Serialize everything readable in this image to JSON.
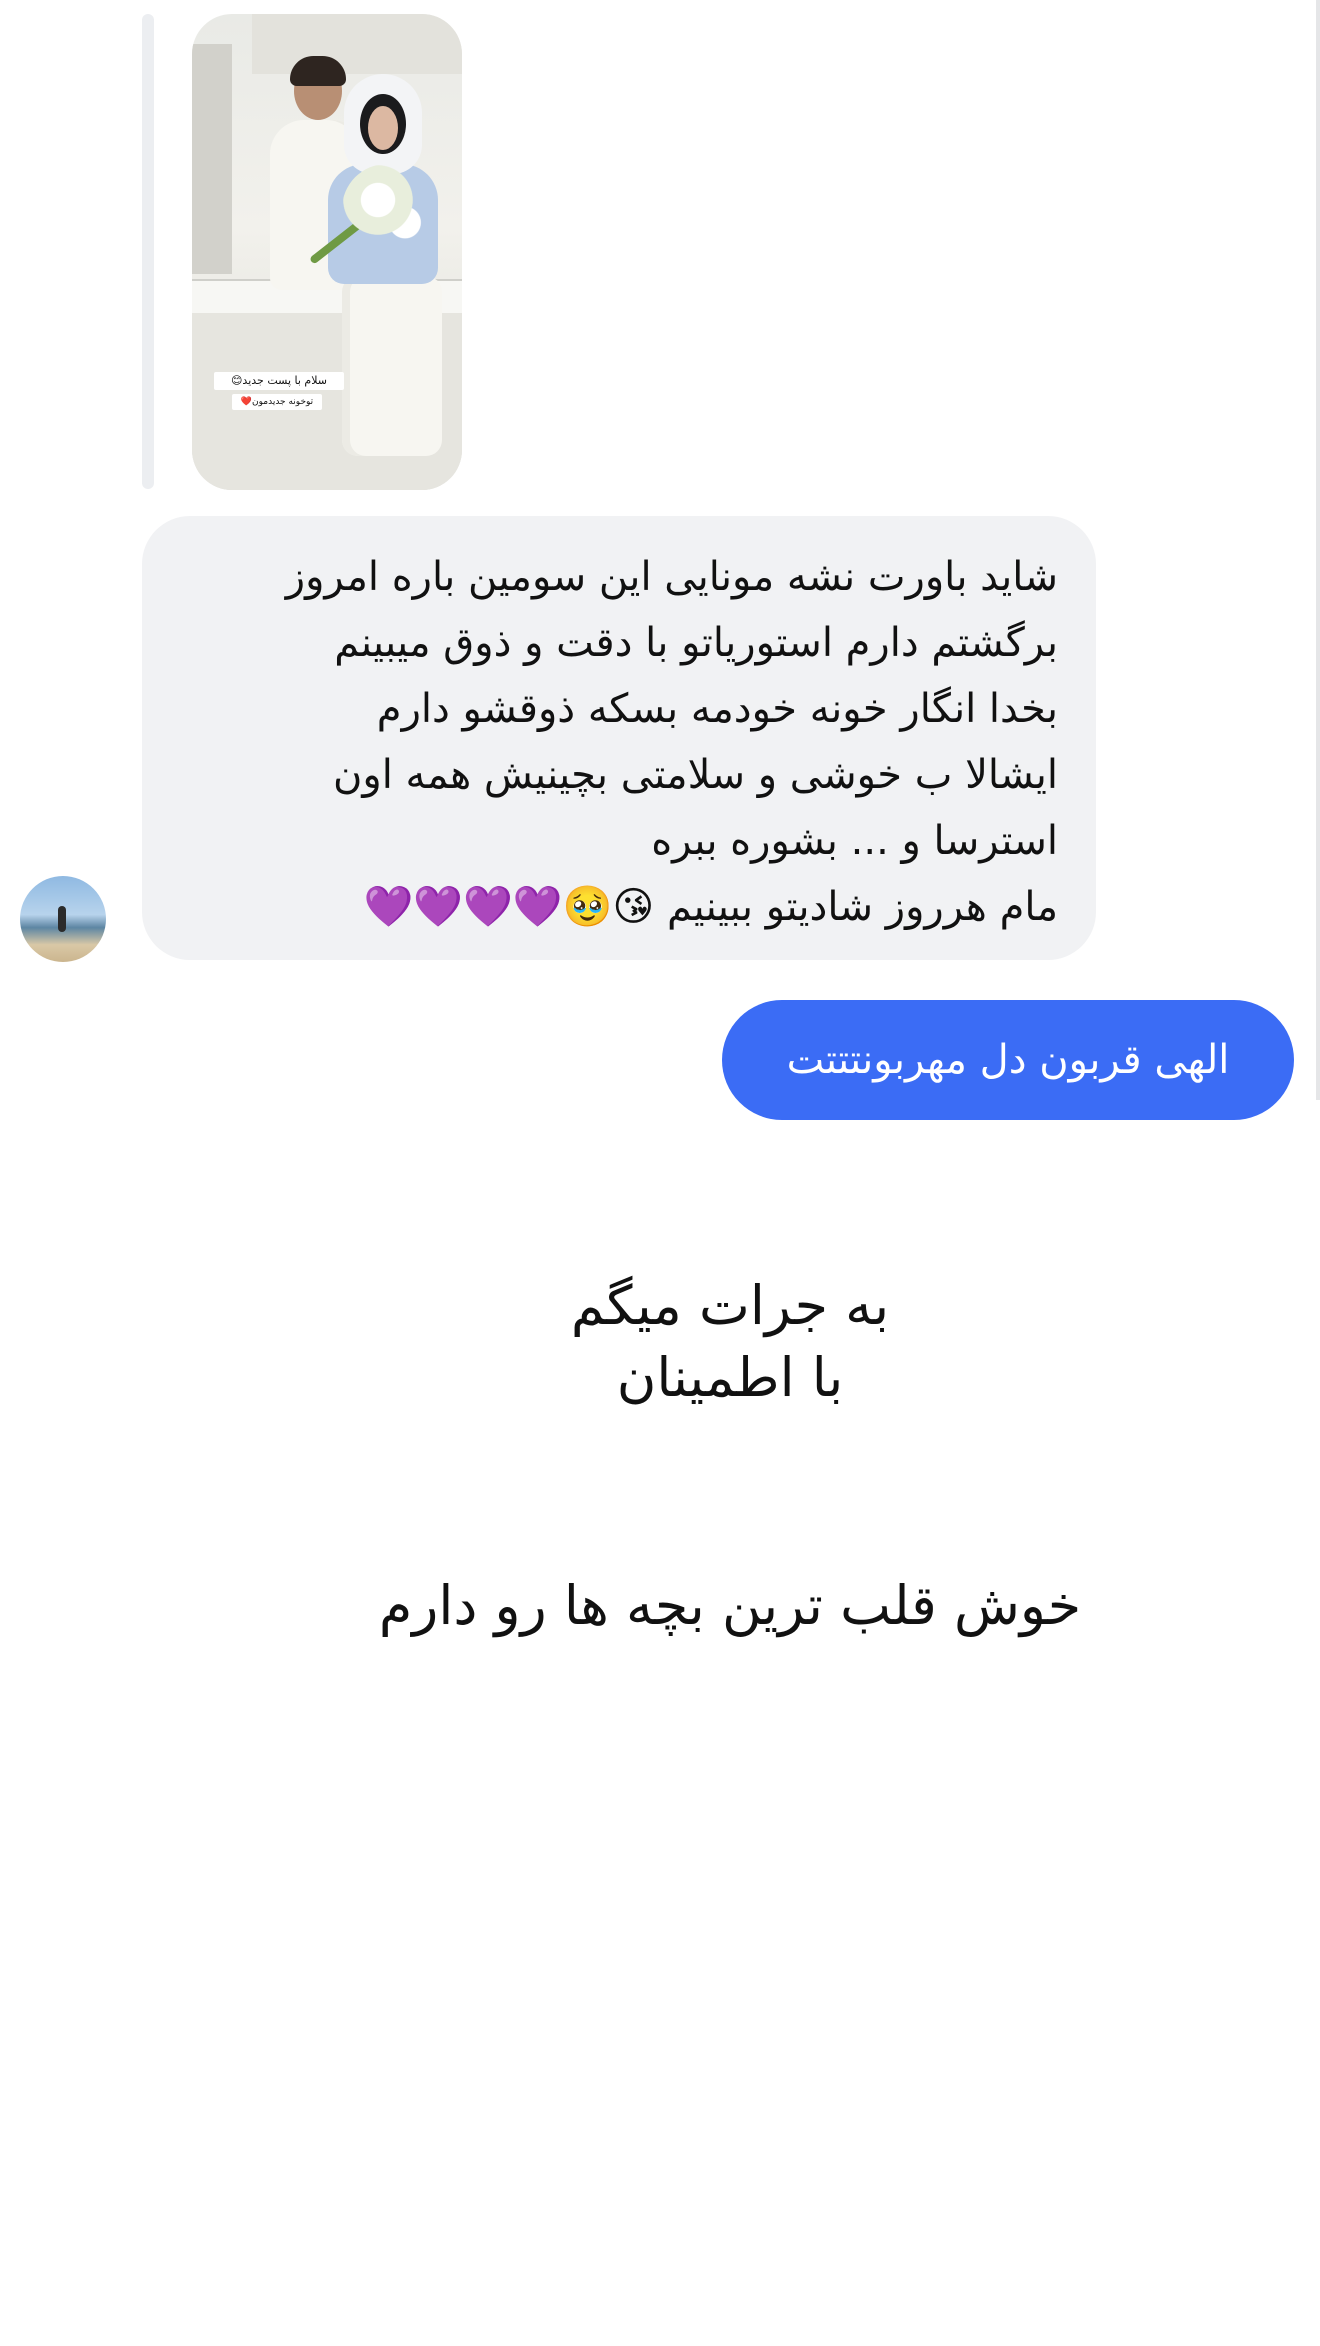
{
  "story_reply": {
    "caption_line1": "سلام با پست جدید😊",
    "caption_line2": "توخونه جدیدمون❤️"
  },
  "incoming_message": {
    "lines": [
      "شاید باورت نشه مونایی این سومین باره امروز",
      "برگشتم دارم استوریاتو با دقت و ذوق میبینم",
      "بخدا انگار خونه خودمه بسکه ذوقشو دارم",
      "ایشالا ب خوشی و سلامتی بچینیش همه اون",
      "استرسا و ... بشوره ببره",
      "مام هرروز شادیتو ببینیم 😘🥹💜💜💜💜"
    ]
  },
  "outgoing_message": {
    "text": "الهی قربون دل مهربونتتتت"
  },
  "overlay_text": {
    "line1": "به جرات میگم",
    "line2": "با اطمینان",
    "line3": "خوش قلب ترین بچه ها رو دارم"
  }
}
